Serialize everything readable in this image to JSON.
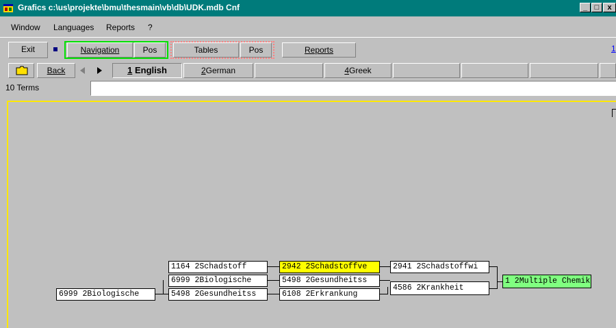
{
  "window": {
    "title": "Grafics c:\\us\\projekte\\bmu\\thesmain\\vb\\db\\UDK.mdb Cnf",
    "controls": {
      "minimize": "_",
      "maximize": "□",
      "close": "x"
    }
  },
  "menu": [
    "Window",
    "Languages",
    "Reports",
    "?"
  ],
  "toolbar": {
    "exit": "Exit",
    "navigation": "Navigation",
    "nav_pos": "Pos",
    "tables": "Tables",
    "tables_pos": "Pos",
    "reports": "Reports",
    "right_edge": "1"
  },
  "langbar": {
    "back": "Back",
    "lang1_num": "1",
    "lang1": "English",
    "lang2_num": "2",
    "lang2": "German",
    "lang4_num": "4",
    "lang4": "Greek"
  },
  "terms": {
    "label": "10 Terms",
    "value": ""
  },
  "graph": {
    "nodes": [
      {
        "id": "n0",
        "text": "6999 2Biologische"
      },
      {
        "id": "n1",
        "text": "1164 2Schadstoff"
      },
      {
        "id": "n2",
        "text": "6999 2Biologische"
      },
      {
        "id": "n3",
        "text": "5498 2Gesundheitss"
      },
      {
        "id": "n4",
        "text": "2942 2Schadstoffve"
      },
      {
        "id": "n5",
        "text": "5498 2Gesundheitss"
      },
      {
        "id": "n6",
        "text": "6108 2Erkrankung"
      },
      {
        "id": "n7",
        "text": "2941 2Schadstoffwi"
      },
      {
        "id": "n8",
        "text": "4586 2Krankheit"
      },
      {
        "id": "n9",
        "text": "1 2Multiple Chemik"
      }
    ]
  },
  "colors": {
    "titlebar": "#007b7b",
    "face": "#c0c0c0",
    "highlight_node": "#ffff00",
    "terminal_node": "#80ff80",
    "navigation_group": "#00e000",
    "tables_group": "#ff8080",
    "graph_border": "#ffe800"
  },
  "icons": {
    "app": "app-icon",
    "open": "folder-icon",
    "nav_marker": "square-icon",
    "prev": "triangle-left-icon",
    "next": "triangle-right-icon"
  }
}
